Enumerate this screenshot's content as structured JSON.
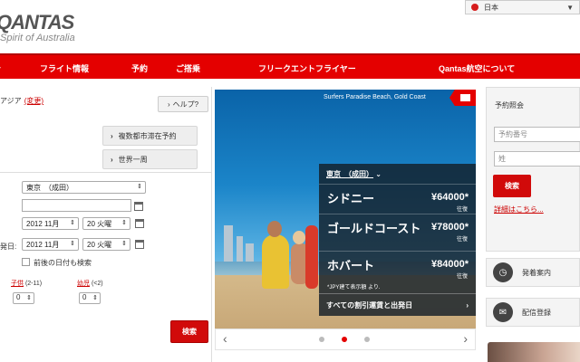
{
  "header": {
    "logo_text": "QANTAS",
    "logo_tagline": "Spirit of Australia",
    "language": "日本"
  },
  "nav": {
    "items": [
      "フライト情報",
      "予約",
      "ご搭乗",
      "フリークエントフライヤー",
      "Qantas航空について"
    ]
  },
  "booking": {
    "region_text": "アジア",
    "region_link": "(変更)",
    "help_label": "ヘルプ?",
    "multi_city_label": "複数都市滞在予約",
    "round_world_label": "世界一周",
    "origin_value": "東京　（成田）",
    "depart_date": {
      "month": "2012 11月",
      "day": "20 火曜"
    },
    "return_label": "発日:",
    "return_date": {
      "month": "2012 11月",
      "day": "20 火曜"
    },
    "flexible_label": "前後の日付も検索",
    "child_label": "子供",
    "child_range": "(2-11)",
    "infant_label": "幼児",
    "infant_range": "(<2)",
    "child_value": "0",
    "infant_value": "0",
    "search_label": "検索"
  },
  "hero": {
    "caption": "Surfers Paradise Beach, Gold Coast",
    "origin": "東京　（成田）",
    "fares": [
      {
        "destination": "シドニー",
        "price": "¥64000*",
        "note": "往復"
      },
      {
        "destination": "ゴールドコースト",
        "price": "¥78000*",
        "note": "往復"
      },
      {
        "destination": "ホバート",
        "price": "¥84000*",
        "note": "往復"
      }
    ],
    "footnote": "*JPY建て表示額 より.",
    "all_fares_link": "すべての割引運賃と出発日",
    "slides": 3,
    "active_slide": 2
  },
  "sidebar": {
    "title": "予約照会",
    "booking_ref_placeholder": "予約番号",
    "surname_placeholder": "姓",
    "search_label": "検索",
    "details_link": "詳細はこちら...",
    "tiles": [
      {
        "label": "発着案内",
        "icon": "clock-icon"
      },
      {
        "label": "配信登録",
        "icon": "mail-icon"
      }
    ]
  },
  "colors": {
    "brand_red": "#e40000",
    "panel_gray": "#f4f4f4"
  }
}
